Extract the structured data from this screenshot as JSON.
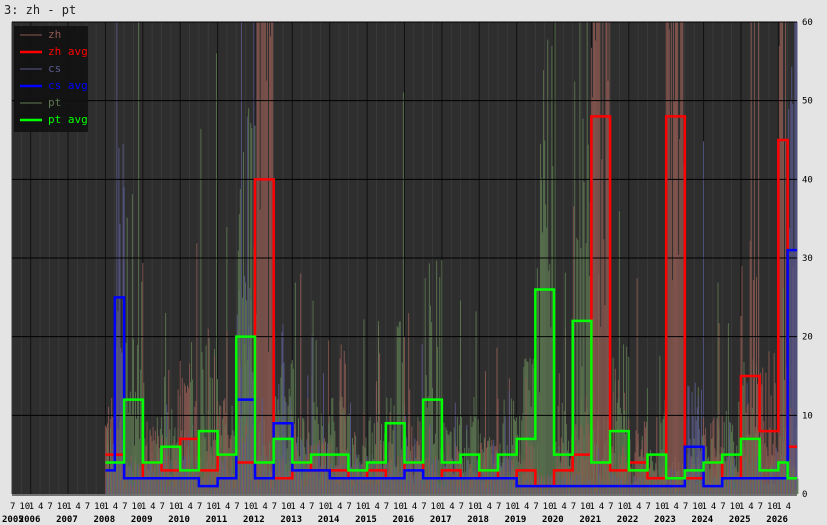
{
  "window": {
    "title": "3: zh - pt"
  },
  "colors": {
    "background": "#e4e4e4",
    "plot_bg": "#2e2e2e",
    "zh": "#8e5a52",
    "zh_avg": "#ff0000",
    "cs": "#5a5a8e",
    "cs_avg": "#0000ff",
    "pt": "#5e7a52",
    "pt_avg": "#00ff00"
  },
  "chart_data": {
    "type": "line",
    "ylim": [
      0,
      60
    ],
    "y_ticks": [
      0,
      10,
      20,
      30,
      40,
      50,
      60
    ],
    "grid": true,
    "legend_position": "top-left",
    "legend": [
      "zh",
      "zh avg",
      "cs",
      "cs avg",
      "pt",
      "pt avg"
    ],
    "x_start": "2005-07",
    "month_tick_labels": [
      "7",
      "10",
      "1",
      "4"
    ],
    "years": [
      "2005",
      "2006",
      "2007",
      "2008",
      "2009",
      "2010",
      "2011",
      "2012",
      "2013",
      "2014",
      "2015",
      "2016",
      "2017",
      "2018",
      "2019",
      "2020",
      "2021",
      "2022",
      "2023",
      "2024",
      "2025",
      "2026"
    ],
    "series": [
      {
        "name": "zh avg",
        "x": [
          "2008-01",
          "2008-07",
          "2009-01",
          "2009-07",
          "2010-01",
          "2010-07",
          "2011-01",
          "2011-07",
          "2012-01",
          "2012-07",
          "2013-01",
          "2013-07",
          "2014-01",
          "2014-07",
          "2015-01",
          "2015-07",
          "2016-01",
          "2016-07",
          "2017-01",
          "2017-07",
          "2018-01",
          "2018-07",
          "2019-01",
          "2019-07",
          "2020-01",
          "2020-07",
          "2021-01",
          "2021-07",
          "2022-01",
          "2022-07",
          "2023-01",
          "2023-07",
          "2024-01",
          "2024-07",
          "2025-01",
          "2025-07",
          "2026-01",
          "2026-04"
        ],
        "values": [
          5,
          2,
          4,
          3,
          7,
          3,
          5,
          4,
          40,
          2,
          4,
          3,
          3,
          2,
          3,
          2,
          4,
          2,
          3,
          2,
          3,
          2,
          3,
          1,
          3,
          5,
          48,
          3,
          4,
          2,
          48,
          2,
          4,
          2,
          15,
          8,
          45,
          6
        ]
      },
      {
        "name": "cs avg",
        "x": [
          "2008-01",
          "2008-04",
          "2008-07",
          "2009-01",
          "2009-07",
          "2010-01",
          "2010-07",
          "2011-01",
          "2011-07",
          "2012-01",
          "2012-07",
          "2013-01",
          "2013-07",
          "2014-01",
          "2014-07",
          "2015-01",
          "2015-07",
          "2016-01",
          "2016-07",
          "2017-01",
          "2017-07",
          "2018-01",
          "2018-07",
          "2019-01",
          "2019-07",
          "2020-01",
          "2020-07",
          "2021-01",
          "2021-07",
          "2022-01",
          "2022-07",
          "2023-01",
          "2023-07",
          "2024-01",
          "2024-07",
          "2025-01",
          "2025-07",
          "2026-01",
          "2026-04"
        ],
        "values": [
          3,
          25,
          2,
          2,
          2,
          2,
          1,
          2,
          12,
          2,
          9,
          3,
          3,
          2,
          2,
          2,
          2,
          3,
          2,
          2,
          2,
          2,
          2,
          1,
          1,
          1,
          1,
          1,
          1,
          1,
          1,
          1,
          6,
          1,
          2,
          2,
          2,
          2,
          31
        ]
      },
      {
        "name": "pt avg",
        "x": [
          "2008-01",
          "2008-07",
          "2009-01",
          "2009-07",
          "2010-01",
          "2010-07",
          "2011-01",
          "2011-07",
          "2012-01",
          "2012-07",
          "2013-01",
          "2013-07",
          "2014-01",
          "2014-07",
          "2015-01",
          "2015-07",
          "2016-01",
          "2016-07",
          "2017-01",
          "2017-07",
          "2018-01",
          "2018-07",
          "2019-01",
          "2019-07",
          "2020-01",
          "2020-07",
          "2021-01",
          "2021-07",
          "2022-01",
          "2022-07",
          "2023-01",
          "2023-07",
          "2024-01",
          "2024-07",
          "2025-01",
          "2025-07",
          "2026-01",
          "2026-04"
        ],
        "values": [
          4,
          12,
          4,
          6,
          3,
          8,
          5,
          20,
          4,
          7,
          4,
          5,
          5,
          3,
          4,
          9,
          4,
          12,
          4,
          5,
          3,
          5,
          7,
          26,
          5,
          22,
          4,
          8,
          3,
          5,
          2,
          3,
          4,
          5,
          7,
          3,
          4,
          2
        ]
      }
    ]
  }
}
